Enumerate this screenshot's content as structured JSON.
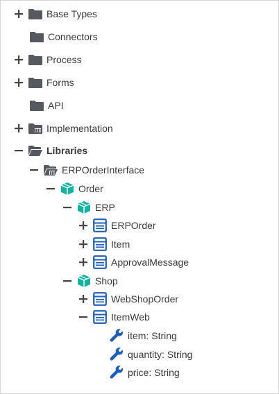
{
  "tree": {
    "base_types": "Base Types",
    "connectors": "Connectors",
    "process": "Process",
    "forms": "Forms",
    "api": "API",
    "implementation": "Implementation",
    "libraries": "Libraries",
    "erp_order_interface": "ERPOrderInterface",
    "order": "Order",
    "erp": "ERP",
    "erp_order": "ERPOrder",
    "item": "Item",
    "approval_message": "ApprovalMessage",
    "shop": "Shop",
    "web_shop_order": "WebShopOrder",
    "item_web": "ItemWeb",
    "field_item": "item: String",
    "field_quantity": "quantity: String",
    "field_price": "price: String"
  },
  "colors": {
    "folder": "#555a60",
    "package": "#16b2a0",
    "type": "#1c5fb8",
    "wrench": "#1c5fb8"
  }
}
